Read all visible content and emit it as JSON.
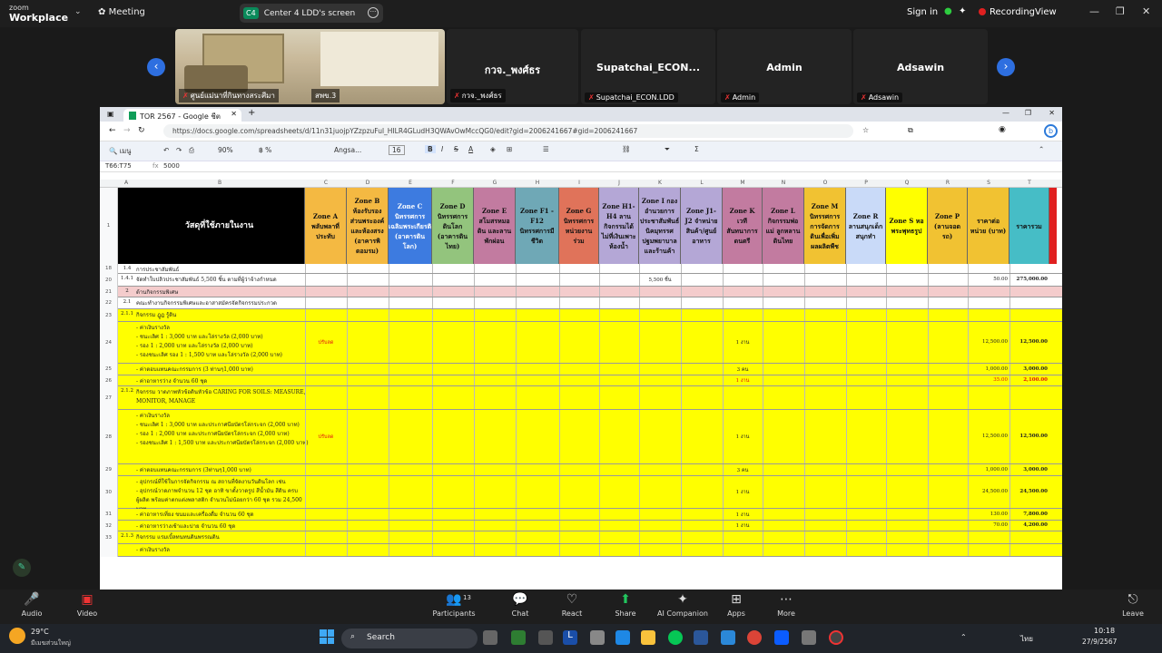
{
  "zoom": {
    "brand_top": "zoom",
    "brand_bottom": "Workplace",
    "meeting_label": "Meeting",
    "share_badge": "C4",
    "share_title": "Center 4 LDD's screen",
    "sign_in": "Sign in",
    "recording": "Recording",
    "view": "View"
  },
  "participants": [
    {
      "name": "",
      "label": "ศูนย์แม่นาที่กินทางสระศีมา",
      "second_label": "สพข.3"
    },
    {
      "name": "กวจ._พงศ์ธร",
      "label": "กวจ._พงศ์ธร"
    },
    {
      "name": "Supatchai_ECON...",
      "label": "Supatchai_ECON.LDD"
    },
    {
      "name": "Admin",
      "label": "Admin"
    },
    {
      "name": "Adsawin",
      "label": "Adsawin"
    }
  ],
  "browser": {
    "tab_title": "TOR 2567 - Google ชีต",
    "url": "https://docs.google.com/spreadsheets/d/11n31juojpYZzpzuFul_HILR4GLudH3QWAvOwMccQG0/edit?gid=2006241667#gid=2006241667",
    "menu_search": "เมนู",
    "zoom_level": "90%",
    "font_name": "Angsa...",
    "font_size": "16",
    "cell_ref": "T66:T75",
    "formula": "5000"
  },
  "sheet": {
    "columns": [
      "A",
      "B",
      "C",
      "D",
      "E",
      "F",
      "G",
      "H",
      "I",
      "J",
      "K",
      "L",
      "M",
      "N",
      "O",
      "P",
      "Q",
      "R",
      "S",
      "T"
    ],
    "header_title": "วัสดุที่ใช้ภายในงาน",
    "header_cells": [
      {
        "text": "Zone A พลับพลาที่ประทับ",
        "color": "#f4b942"
      },
      {
        "text": "Zone B ห้องรับรองส่วนพระองค์และห้องสรง (อาคารพิดอมรม)",
        "color": "#f4b942"
      },
      {
        "text": "Zone C นิทรรศการเฉลิมพระเกียรติ (อาคารดินโลก)",
        "color": "#3d7be0"
      },
      {
        "text": "Zone D นิทรรศการดินโลก (อาคารดินไทย)",
        "color": "#93c47d"
      },
      {
        "text": "Zone E สโมสรหมอดิน และลานพักผ่อน",
        "color": "#c27ba0"
      },
      {
        "text": "Zone F1 - F12 นิทรรศการมีชีวิต",
        "color": "#6fa8b6"
      },
      {
        "text": "Zone G นิทรรศการหน่วยงานร่วม",
        "color": "#e0735a"
      },
      {
        "text": "Zone H1-H4 ลานกิจกรรมได้ไม่ที่เงินเพาะห้องน้ำ",
        "color": "#b4a7d6"
      },
      {
        "text": "Zone I กองอำนวยการ ประชาสัมพันธ์ นิคมุทรรศ ปฐมพยาบาล และร้านค้า",
        "color": "#b4a7d6"
      },
      {
        "text": "Zone J1-J2 จำหน่ายสินค้า/ศูนย์อาหาร",
        "color": "#b4a7d6"
      },
      {
        "text": "Zone K เวทีสันทนาการดนตรี",
        "color": "#c27ba0"
      },
      {
        "text": "Zone L กิจกรรมพ่อแม่ ลูกหลานดินไทย",
        "color": "#c27ba0"
      },
      {
        "text": "Zone M นิทรรศการการจัดการดินเพื่อเพิ่มผลผลิตพืช",
        "color": "#f1c232"
      },
      {
        "text": "Zone R ลานสนุกเด็กสนุกทำ",
        "color": "#c9daf8"
      },
      {
        "text": "Zone S หอพระพุทธรูป",
        "color": "#ffff00"
      },
      {
        "text": "Zone P (ลานจอดรถ)",
        "color": "#f1c232"
      },
      {
        "text": "ราคาต่อหน่วย (บาท)",
        "color": "#f1c232"
      },
      {
        "text": "ราคารวม",
        "color": "#46bdc6"
      }
    ],
    "rows": [
      {
        "row": "18",
        "num": "1.4",
        "text": "การประชาสัมพันธ์",
        "color": "#ffffff",
        "k": "",
        "m": "",
        "s": "",
        "t": ""
      },
      {
        "row": "20",
        "num": "1.4.1",
        "text": "จัดทำใบปลิวประชาสัมพันธ์ 5,500 ชิ้น ตามที่ผู้ว่าจ้างกำหนด",
        "color": "#ffffff",
        "k": "5,500 ชิ้น",
        "m": "",
        "s": "50.00",
        "t": "275,000.00"
      },
      {
        "row": "21",
        "num": "2",
        "text": "ด้านกิจกรรมพิเศษ",
        "color": "#f4cccc",
        "k": "",
        "m": "",
        "s": "",
        "t": ""
      },
      {
        "row": "22",
        "num": "2.1",
        "text": "คณะทำงานกิจกรรมพิเศษและอาสาสมัครจัดกิจกรรมประกวด",
        "color": "#ffffff",
        "k": "",
        "m": "",
        "s": "",
        "t": ""
      },
      {
        "row": "23",
        "num": "2.1.1",
        "text": "กิจกรรม ฎูฎ รู้ดิน",
        "color": "#ffff00",
        "k": "",
        "m": "",
        "s": "",
        "t": ""
      },
      {
        "row": "24",
        "num": "",
        "text": "- ค่าเงินรางวัล\n - ชนะเลิศ 1 : 3,000 บาท และโล่รางวัล (2,000 บาท)\n - รอง 1 : 2,000 บาท และโล่รางวัล (2,000 บาท)\n - รองชนะเลิศ รอง 1 : 1,500 บาท และโล่รางวัล (2,000 บาท)",
        "color": "#ffff00",
        "k": "",
        "m": "1 งาน",
        "s": "12,500.00",
        "t": "12,500.00",
        "c": "ปรับลด"
      },
      {
        "row": "25",
        "num": "",
        "text": "- ค่าตอบแทนคณะกรรมการ (3 ท่านๆ1,000 บาท)",
        "color": "#ffff00",
        "k": "",
        "m": "3 คน",
        "s": "1,000.00",
        "t": "3,000.00"
      },
      {
        "row": "26",
        "num": "",
        "text": "- ค่าอาหารว่าง จำนวน 60 ชุด",
        "color": "#ffff00",
        "k": "",
        "m": "1 งาน",
        "s": "35.00",
        "t": "2,100.00",
        "red": true
      },
      {
        "row": "27",
        "num": "2.1.2",
        "text": "กิจกรรม วาดภาพหัวข้อดินหัวข้อ CARING FOR SOILS: MEASURE, MONITOR, MANAGE",
        "color": "#ffff00",
        "k": "",
        "m": "",
        "s": "",
        "t": ""
      },
      {
        "row": "28",
        "num": "",
        "text": "- ค่าเงินรางวัล\n - ชนะเลิศ 1 : 3,000 บาท และประกาศนียบัตรโล่กระจก (2,000 บาท)\n - รอง 1 : 2,000 บาท และประกาศนียบัตรโล่กระจก (2,000 บาท)\n - รองชนะเลิศ 1 : 1,500 บาท และประกาศนียบัตรโล่กระจก (2,000 บาท)",
        "color": "#ffff00",
        "k": "",
        "m": "1 งาน",
        "s": "12,500.00",
        "t": "12,500.00",
        "c": "ปรับลด"
      },
      {
        "row": "29",
        "num": "",
        "text": "- ค่าตอบแทนคณะกรรมการ (3ท่านๆ1,000 บาท)",
        "color": "#ffff00",
        "k": "",
        "m": "3 คน",
        "s": "1,000.00",
        "t": "3,000.00"
      },
      {
        "row": "30",
        "num": "",
        "text": "- อุปกรณ์ที่ใช้ในการจัดกิจกรรม ณ สถานที่จัดงานวันดินโลก เช่น\n - อุปกรณ์วาดภาพจำนวน 12 ชุด อาทิ ขาตั้งวาดรูป สีน้ำมัน สีดิน ครบ\nผู้ผลิต พร้อมค่าตกแต่งพลาสติก จำนวนไม่น้อยกว่า 60 ชุด รวม 24,500 บาท\nพร้อมค่าแสดงผลงานภาพวาด และผลงานวัสดุ ณ งานวันดินโลก",
        "color": "#ffff00",
        "k": "",
        "m": "1 งาน",
        "s": "24,500.00",
        "t": "24,500.00"
      },
      {
        "row": "31",
        "num": "",
        "text": "- ค่าอาหารเที่ยง ขนมและเครื่องดื่ม จำนวน 60 ชุด",
        "color": "#ffff00",
        "k": "",
        "m": "1 งาน",
        "s": "130.00",
        "t": "7,800.00"
      },
      {
        "row": "32",
        "num": "",
        "text": "- ค่าอาหารว่างเช้าและบ่าย จำนวน 60 ชุด",
        "color": "#ffff00",
        "k": "",
        "m": "1 งาน",
        "s": "70.00",
        "t": "4,200.00"
      },
      {
        "row": "33",
        "num": "2.1.3",
        "text": "กิจกรรม แรมเบิ้ลทนทนดินพรรณดิน",
        "color": "#ffff00",
        "k": "",
        "m": "",
        "s": "",
        "t": ""
      },
      {
        "row": "",
        "num": "",
        "text": "- ค่าเงินรางวัล",
        "color": "#ffff00",
        "k": "",
        "m": "",
        "s": "",
        "t": ""
      }
    ]
  },
  "zoom_controls": [
    {
      "label": "Audio",
      "icon": "mic-icon"
    },
    {
      "label": "Video",
      "icon": "video-off-icon"
    },
    {
      "label": "Participants",
      "icon": "participants-icon",
      "badge": "13"
    },
    {
      "label": "Chat",
      "icon": "chat-icon"
    },
    {
      "label": "React",
      "icon": "heart-icon"
    },
    {
      "label": "Share",
      "icon": "share-icon"
    },
    {
      "label": "AI Companion",
      "icon": "sparkle-icon"
    },
    {
      "label": "Apps",
      "icon": "apps-icon"
    },
    {
      "label": "More",
      "icon": "more-icon"
    },
    {
      "label": "Leave",
      "icon": "leave-icon"
    }
  ],
  "taskbar": {
    "temp": "29°C",
    "weather": "มีเมฆส่วนใหญ่",
    "search_placeholder": "Search",
    "lang": "ไทย",
    "time": "10:18",
    "date": "27/9/2567"
  }
}
